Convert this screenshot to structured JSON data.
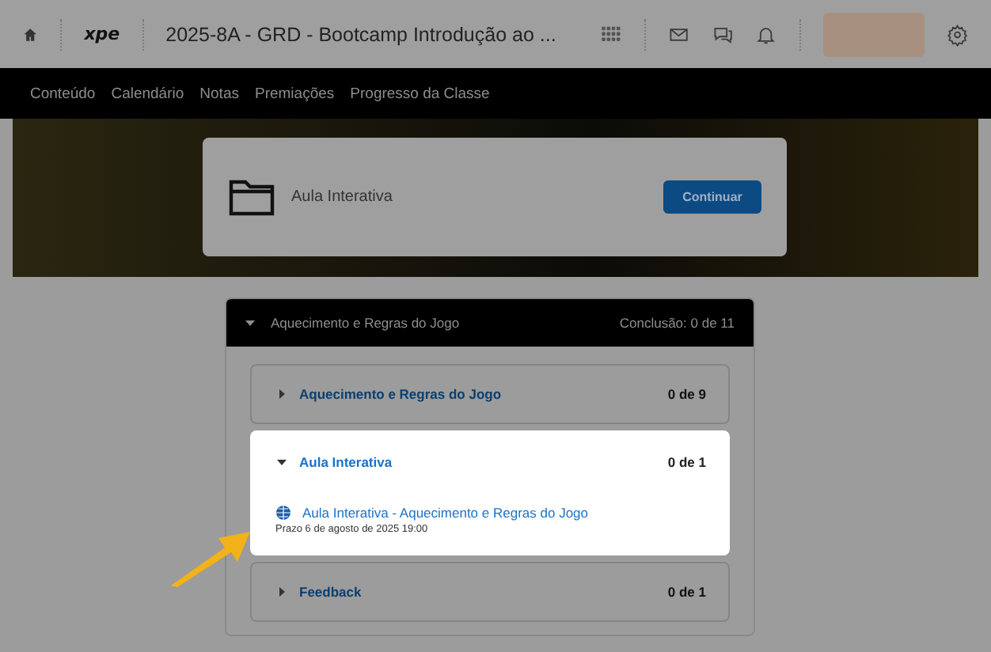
{
  "header": {
    "logo": "xpe",
    "title": "2025-8A - GRD - Bootcamp Introdução ao ..."
  },
  "nav": [
    {
      "label": "Conteúdo"
    },
    {
      "label": "Calendário"
    },
    {
      "label": "Notas"
    },
    {
      "label": "Premiações"
    },
    {
      "label": "Progresso da Classe"
    }
  ],
  "dialog": {
    "title": "Aula Interativa",
    "button": "Continuar"
  },
  "module": {
    "title": "Aquecimento e Regras do Jogo",
    "completion": "Conclusão: 0 de 11",
    "expanded": true,
    "items": [
      {
        "title": "Aquecimento e Regras do Jogo",
        "count": "0 de 9",
        "expanded": false,
        "highlighted": false
      },
      {
        "title": "Aula Interativa",
        "count": "0 de 1",
        "expanded": true,
        "highlighted": true,
        "activities": [
          {
            "title": "Aula Interativa - Aquecimento e Regras do Jogo",
            "due": "Prazo 6 de agosto de 2025 19:00"
          }
        ]
      },
      {
        "title": "Feedback",
        "count": "0 de 1",
        "expanded": false,
        "highlighted": false
      }
    ]
  }
}
